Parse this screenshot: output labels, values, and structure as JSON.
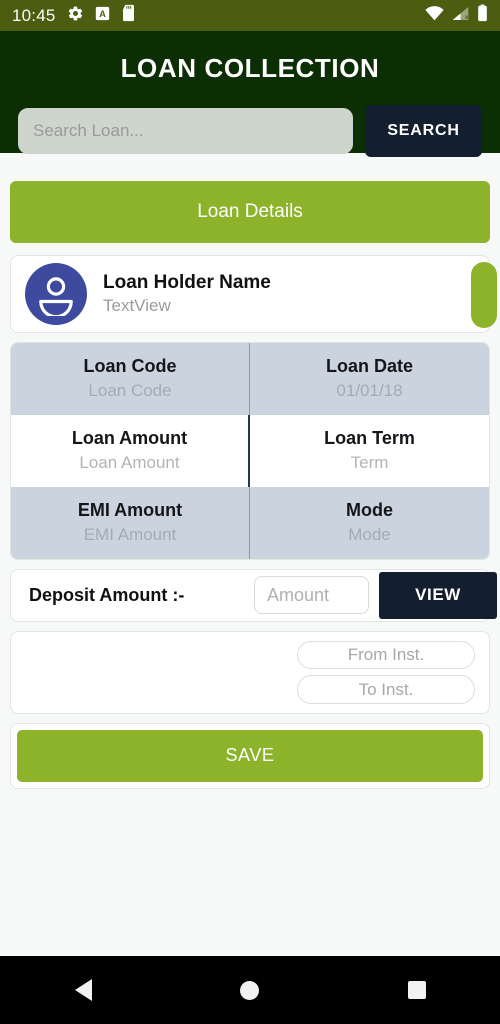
{
  "status_bar": {
    "time": "10:45",
    "left_icons": [
      "gear-icon",
      "a-box-icon",
      "sd-card-icon"
    ],
    "right_icons": [
      "wifi-icon",
      "cell-signal-no-sim-icon",
      "battery-icon"
    ],
    "background_color": "#4c5c10"
  },
  "header": {
    "title": "LOAN COLLECTION",
    "background_color": "#0b2f02"
  },
  "search": {
    "placeholder": "Search Loan...",
    "value": "",
    "button_label": "SEARCH",
    "button_color": "#131e2e"
  },
  "section": {
    "loan_details_label": "Loan Details",
    "accent_color": "#8db32b"
  },
  "holder": {
    "name": "Loan Holder Name",
    "subtitle": "TextView",
    "avatar_color": "#3d4a9e"
  },
  "details_table": {
    "rows": [
      {
        "shaded": true,
        "cells": [
          {
            "label": "Loan Code",
            "value": "Loan Code"
          },
          {
            "label": "Loan Date",
            "value": "01/01/18"
          }
        ]
      },
      {
        "shaded": false,
        "cells": [
          {
            "label": "Loan Amount",
            "value": "Loan Amount"
          },
          {
            "label": "Loan Term",
            "value": "Term"
          }
        ]
      },
      {
        "shaded": true,
        "cells": [
          {
            "label": "EMI Amount",
            "value": "EMI Amount"
          },
          {
            "label": "Mode",
            "value": "Mode"
          }
        ]
      }
    ],
    "shaded_color": "#cbd3de"
  },
  "deposit": {
    "label": "Deposit Amount :-",
    "amount_placeholder": "Amount",
    "amount_value": "",
    "view_button_label": "VIEW"
  },
  "installments": {
    "from_placeholder": "From Inst.",
    "from_value": "",
    "to_placeholder": "To Inst.",
    "to_value": ""
  },
  "save": {
    "label": "SAVE"
  },
  "nav_bar": {
    "back": "back-triangle-icon",
    "home": "home-circle-icon",
    "recents": "recents-square-icon"
  }
}
